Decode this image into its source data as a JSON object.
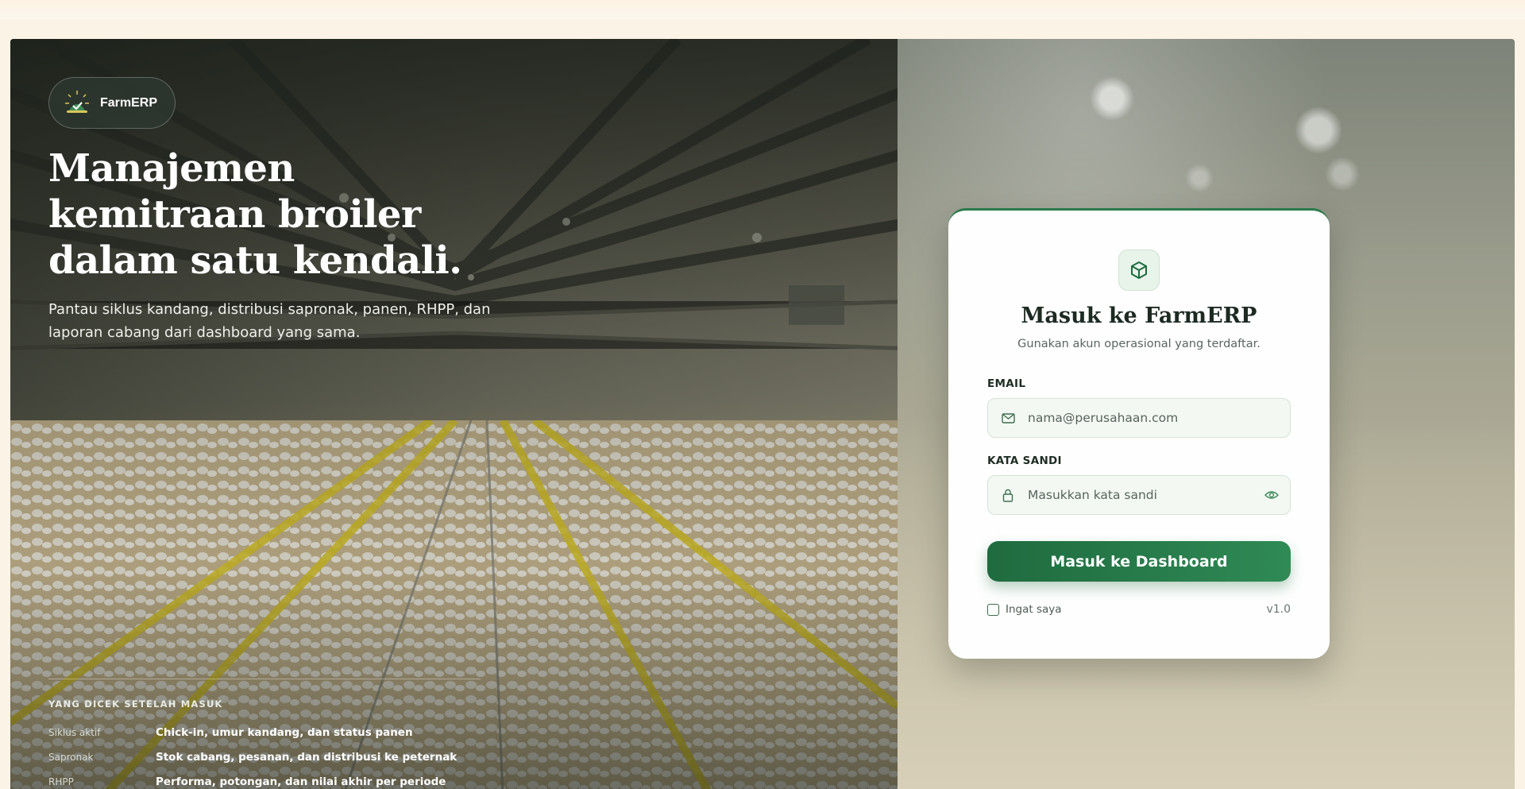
{
  "brand": {
    "name": "FarmERP"
  },
  "hero": {
    "title": "Manajemen kemitraan broiler dalam satu kendali.",
    "subtitle": "Pantau siklus kandang, distribusi sapronak, panen, RHPP, dan laporan cabang dari dashboard yang sama."
  },
  "checks": {
    "heading": "YANG DICEK SETELAH MASUK",
    "items": [
      {
        "key": "Siklus aktif",
        "value": "Chick-in, umur kandang, dan status panen"
      },
      {
        "key": "Sapronak",
        "value": "Stok cabang, pesanan, dan distribusi ke peternak"
      },
      {
        "key": "RHPP",
        "value": "Performa, potongan, dan nilai akhir per periode"
      }
    ]
  },
  "login": {
    "icon": "box-icon",
    "title": "Masuk ke FarmERP",
    "subtitle": "Gunakan akun operasional yang terdaftar.",
    "email_label": "EMAIL",
    "email_placeholder": "nama@perusahaan.com",
    "email_value": "",
    "password_label": "KATA SANDI",
    "password_placeholder": "Masukkan kata sandi",
    "password_value": "",
    "submit_label": "Masuk ke Dashboard",
    "remember_label": "Ingat saya",
    "version": "v1.0"
  },
  "colors": {
    "accent": "#2b7a4b",
    "button_start": "#1f6b3f",
    "button_end": "#2f8a55",
    "page_bg": "#fbf3e6"
  }
}
